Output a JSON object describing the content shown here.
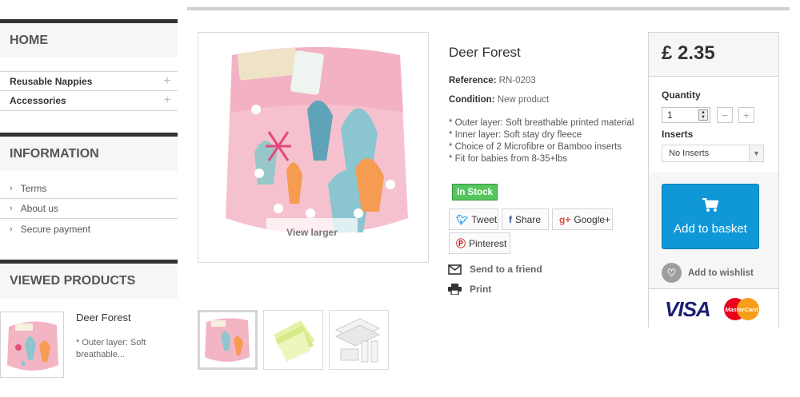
{
  "sidebar": {
    "home_title": "HOME",
    "categories": [
      {
        "label": "Reusable Nappies",
        "toggle": "+"
      },
      {
        "label": "Accessories",
        "toggle": "+"
      }
    ],
    "information_title": "INFORMATION",
    "information_links": [
      {
        "label": "Terms"
      },
      {
        "label": "About us"
      },
      {
        "label": "Secure payment"
      }
    ],
    "viewed_title": "VIEWED PRODUCTS",
    "viewed_item": {
      "title": "Deer Forest",
      "desc": "* Outer layer: Soft breathable..."
    }
  },
  "product": {
    "image_overlay": "View larger",
    "title": "Deer Forest",
    "reference_label": "Reference:",
    "reference_value": "RN-0203",
    "condition_label": "Condition:",
    "condition_value": "New product",
    "description": [
      "* Outer layer: Soft breathable printed material",
      "* Inner layer: Soft stay dry fleece",
      "* Choice of 2 Microfibre or Bamboo inserts",
      "* Fit for babies from 8-35+lbs"
    ],
    "stock_status": "In Stock",
    "share": {
      "tweet": "Tweet",
      "facebook": "Share",
      "google": "Google+",
      "pinterest": "Pinterest"
    },
    "send_to_friend": "Send to a friend",
    "print": "Print"
  },
  "buybox": {
    "price": "£ 2.35",
    "quantity_label": "Quantity",
    "quantity_value": "1",
    "inserts_label": "Inserts",
    "inserts_selected": "No Inserts",
    "add_to_basket": "Add to basket",
    "add_to_wishlist": "Add to wishlist",
    "visa": "VISA",
    "mastercard": "MasterCard"
  },
  "colors": {
    "accent_blue": "#0f97d7",
    "stock_green": "#55c65e",
    "twitter": "#1da1f2",
    "facebook": "#3b5998",
    "google": "#dd4b39",
    "pinterest": "#cb2027"
  },
  "icons": [
    "plus-icon",
    "chevron-right-icon",
    "twitter-icon",
    "facebook-icon",
    "google-plus-icon",
    "pinterest-icon",
    "envelope-icon",
    "printer-icon",
    "cart-icon",
    "heart-icon",
    "visa-logo",
    "mastercard-logo"
  ]
}
